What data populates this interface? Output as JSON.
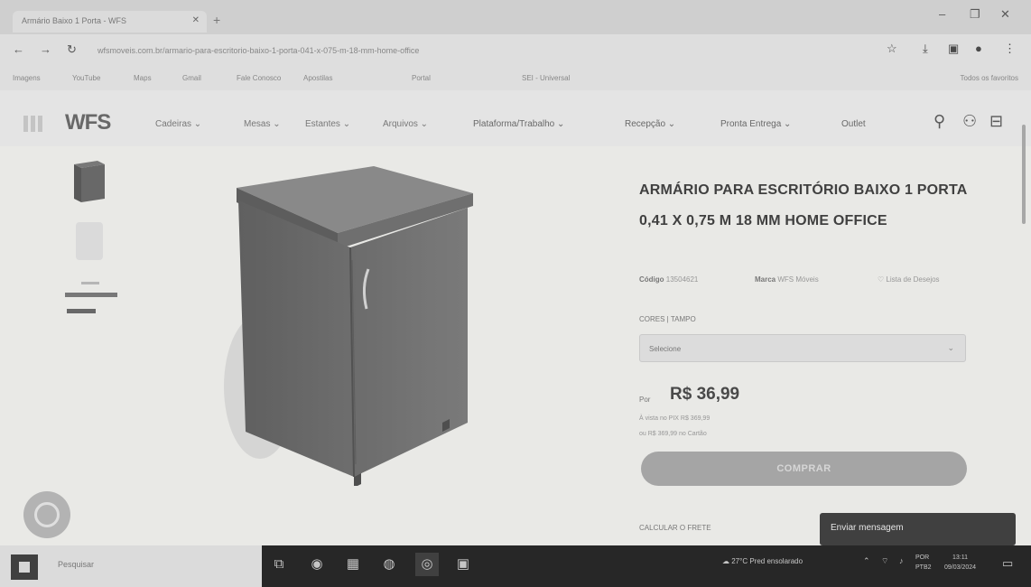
{
  "browser": {
    "tab_title": "Armário Baixo 1 Porta - WFS",
    "url": "wfsmoveis.com.br/armario-para-escritorio-baixo-1-porta-041-x-075-m-18-mm-home-office",
    "bookmarks": [
      "Imagens",
      "YouTube",
      "Maps",
      "Gmail",
      "Fale Conosco",
      "Apostilas",
      "Portal",
      "SEI - Universal"
    ],
    "other_bookmarks": "Todos os favoritos"
  },
  "site": {
    "logo": "WFS",
    "menu": [
      "Cadeiras",
      "Mesas",
      "Estantes",
      "Arquivos",
      "Plataforma/Trabalho",
      "Recepção",
      "Pronta Entrega",
      "Outlet"
    ]
  },
  "product": {
    "title": "ARMÁRIO PARA ESCRITÓRIO BAIXO 1 PORTA 0,41 X 0,75 M 18 MM HOME OFFICE",
    "code_label": "Código",
    "code_value": "13504621",
    "brand_label": "Marca",
    "brand_value": "WFS Móveis",
    "wishlist": "Lista de Desejos",
    "option_label": "CORES | TAMPO",
    "option_value": "Selecione",
    "price_from_label": "Por",
    "price": "R$ 36,99",
    "installments": "À vista no PIX R$ 369,99",
    "card_price": "ou R$ 369,99 no Cartão",
    "buy_button": "COMPRAR",
    "shipping_label": "CALCULAR O FRETE"
  },
  "chat": {
    "message": "Enviar mensagem"
  },
  "taskbar": {
    "search_placeholder": "Pesquisar",
    "weather": "27°C Pred ensolarado",
    "lang": "POR",
    "lang_sub": "PTB2",
    "time": "13:11",
    "date": "09/03/2024"
  }
}
